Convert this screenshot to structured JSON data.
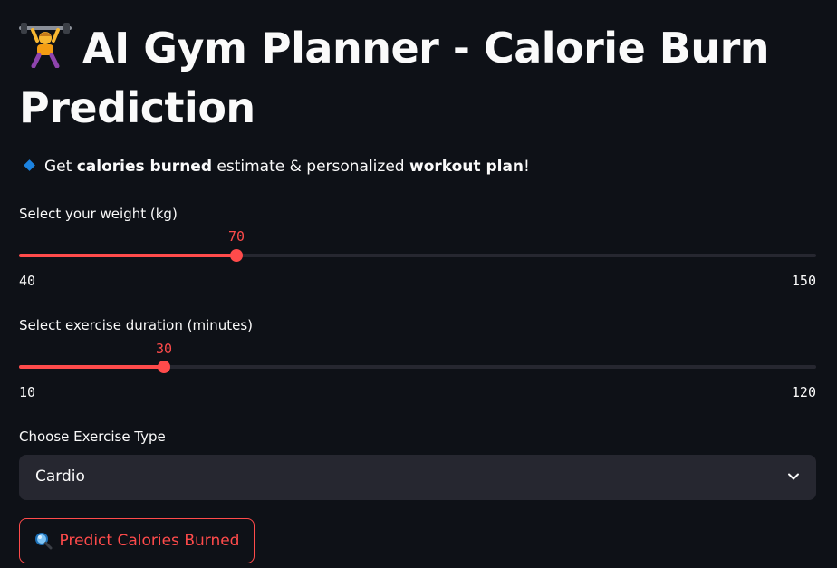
{
  "header": {
    "title_icon": "weightlifter-emoji-icon",
    "title": "AI Gym Planner - Calorie Burn Prediction"
  },
  "intro": {
    "icon": "small-blue-diamond-icon",
    "prefix": "Get ",
    "bold1": "calories burned",
    "middle": " estimate & personalized ",
    "bold2": "workout plan",
    "suffix": "!"
  },
  "weight_slider": {
    "label": "Select your weight (kg)",
    "value": "70",
    "min": "40",
    "max": "150",
    "value_num": 70,
    "min_num": 40,
    "max_num": 150
  },
  "duration_slider": {
    "label": "Select exercise duration (minutes)",
    "value": "30",
    "min": "10",
    "max": "120",
    "value_num": 30,
    "min_num": 10,
    "max_num": 120
  },
  "exercise_select": {
    "label": "Choose Exercise Type",
    "selected": "Cardio",
    "icon": "chevron-down-icon"
  },
  "predict_button": {
    "icon": "magnifying-glass-emoji-icon",
    "label": "Predict Calories Burned"
  },
  "colors": {
    "background": "#0e1117",
    "accent": "#ff4b4b",
    "track": "#262730",
    "text": "#fafafa"
  }
}
